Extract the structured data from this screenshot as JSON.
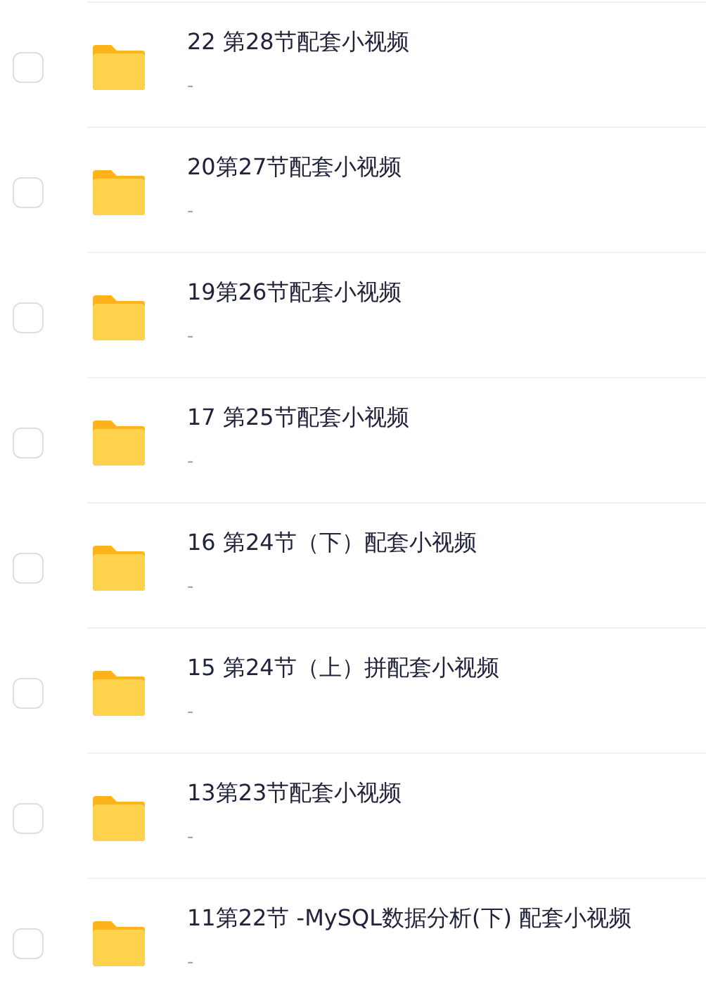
{
  "files": [
    {
      "name": "22 第28节配套小视频",
      "detail": "-",
      "checked": false
    },
    {
      "name": "20第27节配套小视频",
      "detail": "-",
      "checked": false
    },
    {
      "name": "19第26节配套小视频",
      "detail": "-",
      "checked": false
    },
    {
      "name": "17 第25节配套小视频",
      "detail": "-",
      "checked": false
    },
    {
      "name": "16 第24节（下）配套小视频",
      "detail": "-",
      "checked": false
    },
    {
      "name": "15 第24节（上）拼配套小视频",
      "detail": "-",
      "checked": false
    },
    {
      "name": "13第23节配套小视频",
      "detail": "-",
      "checked": false
    },
    {
      "name": "11第22节 -MySQL数据分析(下) 配套小视频",
      "detail": "-",
      "checked": false
    }
  ]
}
